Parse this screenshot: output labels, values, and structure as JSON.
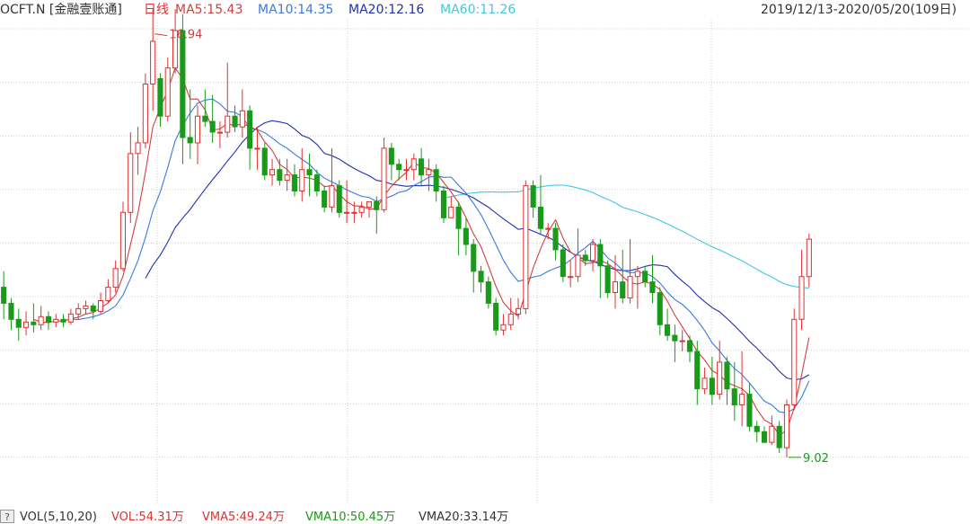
{
  "header": {
    "symbol": "OCFT.N [金融壹账通]",
    "period": "日线",
    "ma5": "MA5:15.43",
    "ma10": "MA10:14.35",
    "ma20": "MA20:12.16",
    "ma60": "MA60:11.26",
    "range": "2019/12/13-2020/05/20(109日)"
  },
  "footer": {
    "help": "?",
    "vol_label": "VOL(5,10,20)",
    "vol": "VOL:54.31万",
    "vma5": "VMA5:49.24万",
    "vma10": "VMA10:50.45万",
    "vma20": "VMA20:33.14万"
  },
  "colors": {
    "up": "#e03030",
    "down": "#1a9a1a",
    "ma5": "#d04040",
    "ma10": "#3a7ae0",
    "ma20": "#2030b0",
    "ma60": "#40c8e0",
    "grid": "#cccccc",
    "header_black": "#333333",
    "header_red": "#e03030"
  },
  "chart_data": {
    "type": "candlestick",
    "x_range": [
      "2019/12/13",
      "2020/05/20"
    ],
    "trading_days": 109,
    "y_estimated_range": [
      8.5,
      17.5
    ],
    "annotations": [
      {
        "text": "16.94",
        "kind": "max",
        "value": 16.94
      },
      {
        "text": "9.02",
        "kind": "min",
        "value": 9.02
      }
    ],
    "candles": [
      [
        12.2,
        11.9,
        12.5,
        11.6
      ],
      [
        11.9,
        11.6,
        12.0,
        11.4
      ],
      [
        11.6,
        11.45,
        11.8,
        11.2
      ],
      [
        11.45,
        11.55,
        11.75,
        11.3
      ],
      [
        11.55,
        11.5,
        11.9,
        11.35
      ],
      [
        11.5,
        11.65,
        11.85,
        11.4
      ],
      [
        11.65,
        11.55,
        11.75,
        11.4
      ],
      [
        11.55,
        11.6,
        11.7,
        11.45
      ],
      [
        11.6,
        11.55,
        11.7,
        11.45
      ],
      [
        11.55,
        11.7,
        11.8,
        11.5
      ],
      [
        11.7,
        11.8,
        11.9,
        11.6
      ],
      [
        11.8,
        11.85,
        11.95,
        11.7
      ],
      [
        11.85,
        11.75,
        11.9,
        11.6
      ],
      [
        11.75,
        11.95,
        12.1,
        11.7
      ],
      [
        11.95,
        12.2,
        12.35,
        11.9
      ],
      [
        12.2,
        12.55,
        12.7,
        12.1
      ],
      [
        12.55,
        13.6,
        13.8,
        12.5
      ],
      [
        13.6,
        14.7,
        15.1,
        13.4
      ],
      [
        14.7,
        14.9,
        15.2,
        14.3
      ],
      [
        14.9,
        16.0,
        16.2,
        14.8
      ],
      [
        16.0,
        16.8,
        17.4,
        15.5
      ],
      [
        16.1,
        15.4,
        16.2,
        15.2
      ],
      [
        15.4,
        16.3,
        16.5,
        15.3
      ],
      [
        16.3,
        17.0,
        17.4,
        16.2
      ],
      [
        17.0,
        15.0,
        17.3,
        14.5
      ],
      [
        15.0,
        14.9,
        15.9,
        14.6
      ],
      [
        14.9,
        15.4,
        15.6,
        14.5
      ],
      [
        15.4,
        15.3,
        15.9,
        15.2
      ],
      [
        15.3,
        15.1,
        15.8,
        14.9
      ],
      [
        15.1,
        15.1,
        15.3,
        14.8
      ],
      [
        15.1,
        15.4,
        16.4,
        15.0
      ],
      [
        15.4,
        15.2,
        15.6,
        15.1
      ],
      [
        15.2,
        15.5,
        15.9,
        15.0
      ],
      [
        15.5,
        14.8,
        15.6,
        14.4
      ],
      [
        14.8,
        14.8,
        15.2,
        14.4
      ],
      [
        14.8,
        14.3,
        14.9,
        14.2
      ],
      [
        14.3,
        14.4,
        14.6,
        14.1
      ],
      [
        14.4,
        14.2,
        14.6,
        14.1
      ],
      [
        14.2,
        14.3,
        14.6,
        14.0
      ],
      [
        14.3,
        14.0,
        14.5,
        13.9
      ],
      [
        14.0,
        14.4,
        14.8,
        13.8
      ],
      [
        14.4,
        14.3,
        14.7,
        13.9
      ],
      [
        14.3,
        14.0,
        14.4,
        13.9
      ],
      [
        14.0,
        13.7,
        14.1,
        13.6
      ],
      [
        13.7,
        14.1,
        14.8,
        13.6
      ],
      [
        14.1,
        13.6,
        14.2,
        13.5
      ],
      [
        13.6,
        13.6,
        14.2,
        13.4
      ],
      [
        13.6,
        13.6,
        13.8,
        13.4
      ],
      [
        13.6,
        13.7,
        13.8,
        13.5
      ],
      [
        13.7,
        13.8,
        13.8,
        13.5
      ],
      [
        13.8,
        13.65,
        13.9,
        13.2
      ],
      [
        13.65,
        14.8,
        15.0,
        13.6
      ],
      [
        14.8,
        14.5,
        14.9,
        14.2
      ],
      [
        14.5,
        14.4,
        14.6,
        14.2
      ],
      [
        14.4,
        14.4,
        14.6,
        14.2
      ],
      [
        14.4,
        14.6,
        14.7,
        14.2
      ],
      [
        14.6,
        14.3,
        14.8,
        14.1
      ],
      [
        14.3,
        14.4,
        14.6,
        14.0
      ],
      [
        14.4,
        14.0,
        14.5,
        13.8
      ],
      [
        14.0,
        13.5,
        14.1,
        13.4
      ],
      [
        13.5,
        13.7,
        13.9,
        13.5
      ],
      [
        13.7,
        13.3,
        13.8,
        12.8
      ],
      [
        13.3,
        13.0,
        13.5,
        12.8
      ],
      [
        13.0,
        12.5,
        13.1,
        12.1
      ],
      [
        12.5,
        12.3,
        12.6,
        12.1
      ],
      [
        12.3,
        11.9,
        12.4,
        11.8
      ],
      [
        11.9,
        11.4,
        12.0,
        11.3
      ],
      [
        11.4,
        11.5,
        11.7,
        11.3
      ],
      [
        11.5,
        11.7,
        12.0,
        11.4
      ],
      [
        11.7,
        11.8,
        12.0,
        11.6
      ],
      [
        11.8,
        14.1,
        14.2,
        11.7
      ],
      [
        14.1,
        13.7,
        14.2,
        13.5
      ],
      [
        13.7,
        13.3,
        14.3,
        13.2
      ],
      [
        13.3,
        13.3,
        13.4,
        13.1
      ],
      [
        13.3,
        12.9,
        13.4,
        12.7
      ],
      [
        12.9,
        12.4,
        13.0,
        12.3
      ],
      [
        12.4,
        12.4,
        12.7,
        12.2
      ],
      [
        12.4,
        12.8,
        13.3,
        12.3
      ],
      [
        12.8,
        12.7,
        12.9,
        12.6
      ],
      [
        12.7,
        13.0,
        13.1,
        12.5
      ],
      [
        13.0,
        12.6,
        13.1,
        12.0
      ],
      [
        12.6,
        12.1,
        12.7,
        12.0
      ],
      [
        12.1,
        12.3,
        12.8,
        11.8
      ],
      [
        12.3,
        12.0,
        12.9,
        11.9
      ],
      [
        12.0,
        12.4,
        13.1,
        11.9
      ],
      [
        12.4,
        12.5,
        12.6,
        11.8
      ],
      [
        12.5,
        12.3,
        12.6,
        12.2
      ],
      [
        12.3,
        12.1,
        12.8,
        11.9
      ],
      [
        12.1,
        11.5,
        12.2,
        11.3
      ],
      [
        11.5,
        11.3,
        11.8,
        11.2
      ],
      [
        11.3,
        11.2,
        11.5,
        10.8
      ],
      [
        11.2,
        11.2,
        11.4,
        11.0
      ],
      [
        11.2,
        11.0,
        11.3,
        10.8
      ],
      [
        11.0,
        10.3,
        11.2,
        10.0
      ],
      [
        10.3,
        10.5,
        10.7,
        10.2
      ],
      [
        10.5,
        10.2,
        10.9,
        10.0
      ],
      [
        10.2,
        10.8,
        11.2,
        10.1
      ],
      [
        10.8,
        10.3,
        10.9,
        10.0
      ],
      [
        10.3,
        10.0,
        10.8,
        9.7
      ],
      [
        10.0,
        10.2,
        11.0,
        9.6
      ],
      [
        10.2,
        9.6,
        10.4,
        9.5
      ],
      [
        9.6,
        9.5,
        9.7,
        9.3
      ],
      [
        9.5,
        9.3,
        9.6,
        9.3
      ],
      [
        9.3,
        9.6,
        9.8,
        9.25
      ],
      [
        9.6,
        9.2,
        9.7,
        9.1
      ],
      [
        9.2,
        10.0,
        10.1,
        9.02
      ],
      [
        10.0,
        11.6,
        11.8,
        9.9
      ],
      [
        11.6,
        12.4,
        12.9,
        11.4
      ],
      [
        12.4,
        13.1,
        13.2,
        12.2
      ]
    ]
  }
}
